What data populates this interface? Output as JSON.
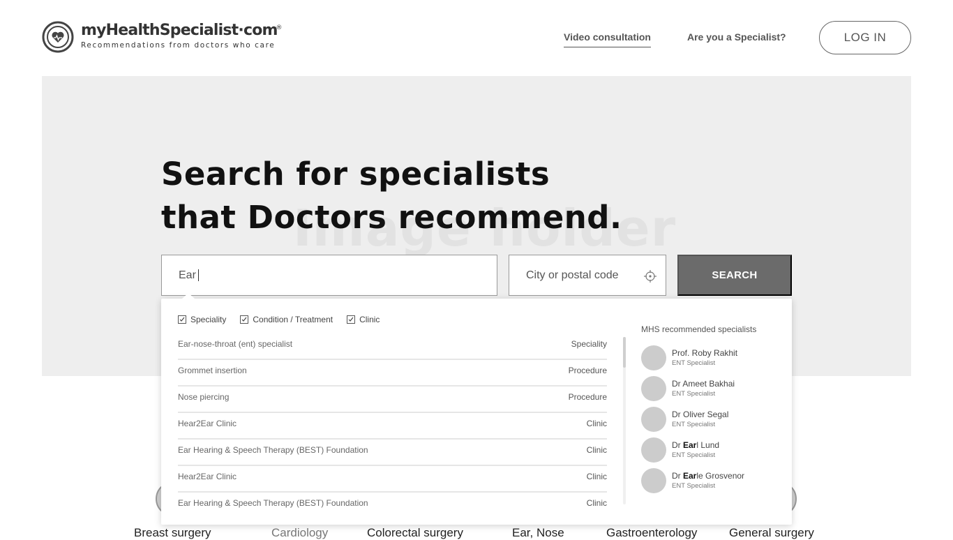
{
  "logo": {
    "name": "myHealthSpecialist·com",
    "registered": "®",
    "tagline": "Recommendations from doctors who care"
  },
  "nav": {
    "video_consultation": "Video consultation",
    "are_you_specialist": "Are you a Specialist?",
    "login": "LOG IN"
  },
  "hero": {
    "placeholder_text": "Image holder",
    "title_line1": "Search for specialists",
    "title_line2": "that Doctors recommend."
  },
  "search": {
    "query_value": "Ear",
    "city_placeholder": "City or postal code",
    "button_label": "SEARCH"
  },
  "dropdown": {
    "filters": [
      {
        "label": "Speciality",
        "checked": true
      },
      {
        "label": "Condition / Treatment",
        "checked": true
      },
      {
        "label": "Clinic",
        "checked": true
      }
    ],
    "results": [
      {
        "name": "Ear-nose-throat (ent) specialist",
        "type": "Speciality"
      },
      {
        "name": "Grommet insertion",
        "type": "Procedure"
      },
      {
        "name": "Nose piercing",
        "type": "Procedure"
      },
      {
        "name": "Hear2Ear Clinic",
        "type": "Clinic"
      },
      {
        "name": "Ear Hearing & Speech Therapy (BEST) Foundation",
        "type": "Clinic"
      },
      {
        "name": "Hear2Ear Clinic",
        "type": "Clinic"
      },
      {
        "name": "Ear Hearing & Speech Therapy (BEST) Foundation",
        "type": "Clinic"
      }
    ],
    "specialists_title": "MHS recommended specialists",
    "specialists": [
      {
        "pre": "Prof. Roby Rakhit",
        "match": "",
        "post": "",
        "role": "ENT Specialist"
      },
      {
        "pre": "Dr Ameet Bakhai",
        "match": "",
        "post": "",
        "role": "ENT Specialist"
      },
      {
        "pre": "Dr Oliver Segal",
        "match": "",
        "post": "",
        "role": "ENT Specialist"
      },
      {
        "pre": "Dr ",
        "match": "Ear",
        "post": "l Lund",
        "role": "ENT Specialist"
      },
      {
        "pre": "Dr ",
        "match": "Ear",
        "post": "le Grosvenor",
        "role": "ENT Specialist"
      }
    ]
  },
  "categories": [
    {
      "label": "Breast surgery"
    },
    {
      "label": "Cardiology"
    },
    {
      "label": "Colorectal surgery"
    },
    {
      "label": "Ear, Nose"
    },
    {
      "label": "Gastroenterology"
    },
    {
      "label": "General surgery"
    }
  ],
  "colors": {
    "search_button": "#6b6b6b",
    "hero_background": "#eeeeee",
    "avatar": "#cccccc"
  }
}
